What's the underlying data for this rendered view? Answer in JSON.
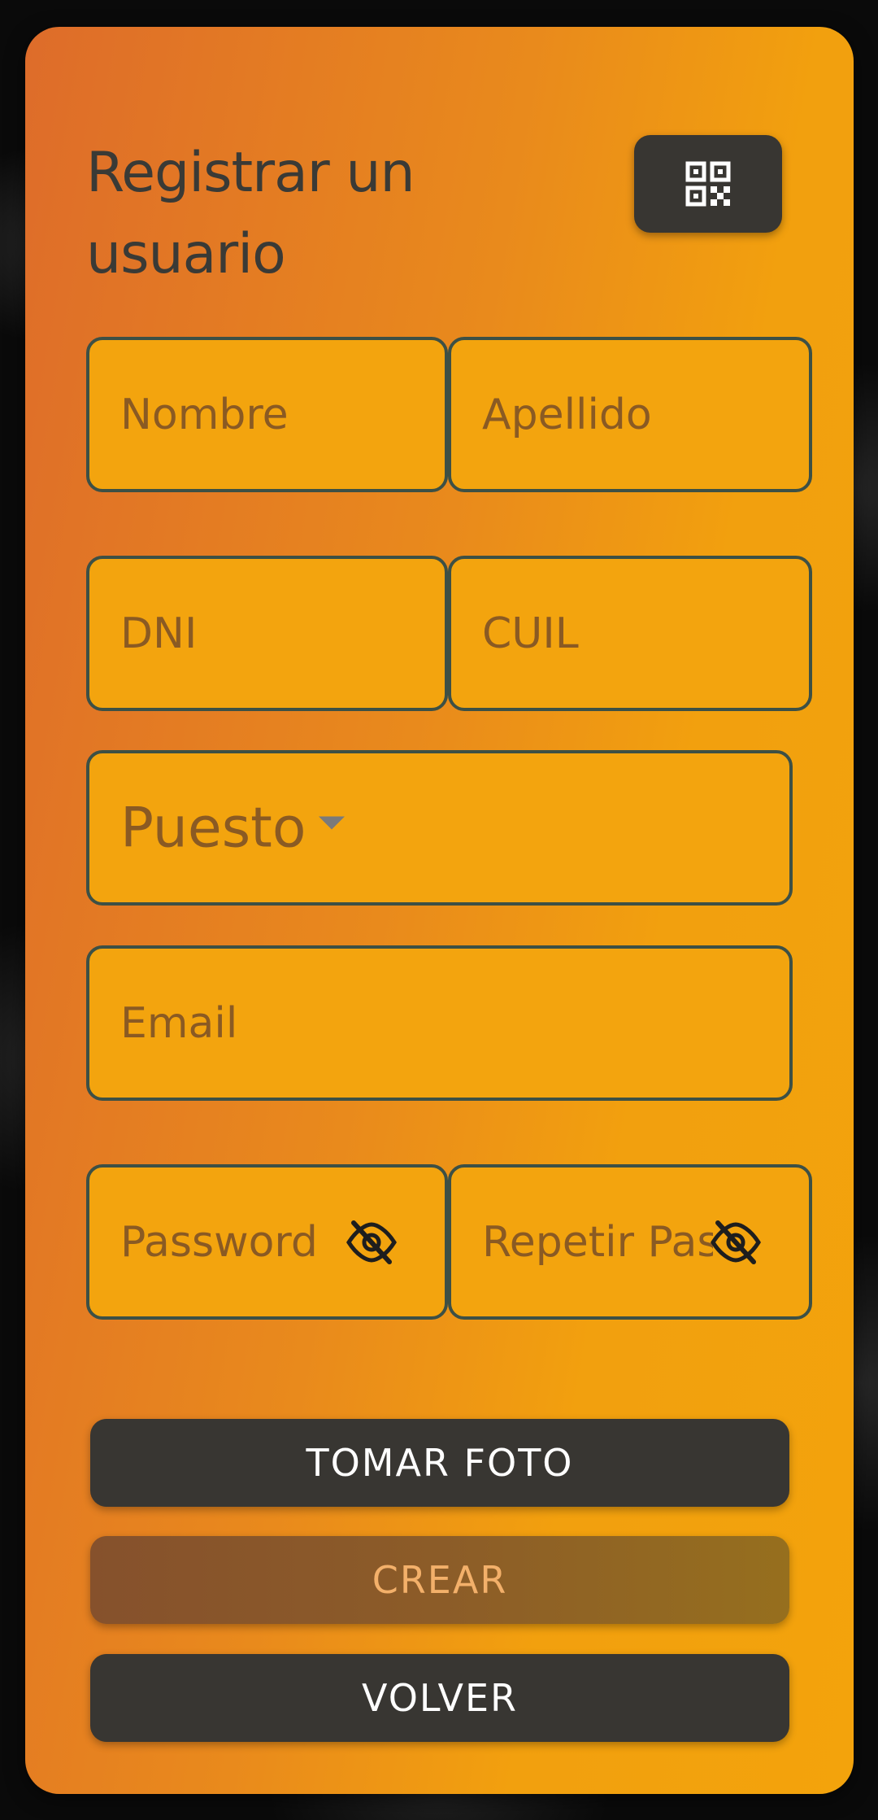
{
  "header": {
    "title": "Registrar un usuario"
  },
  "icons": {
    "qr": "qr-code-icon",
    "eye_off": "eye-off-icon",
    "dropdown": "dropdown-arrow-icon"
  },
  "form": {
    "nombre_placeholder": "Nombre",
    "apellido_placeholder": "Apellido",
    "dni_placeholder": "DNI",
    "cuil_placeholder": "CUIL",
    "puesto_label": "Puesto",
    "email_placeholder": "Email",
    "password_placeholder": "Password",
    "repeat_password_placeholder": "Repetir Password"
  },
  "buttons": {
    "take_photo": "TOMAR FOTO",
    "create": "CREAR",
    "back": "VOLVER"
  },
  "colors": {
    "accent_gradient_start": "#de6c2a",
    "accent_gradient_end": "#f3a30c",
    "dark": "#383632",
    "field_border": "#3d5045",
    "disabled_text": "#f3b06a"
  }
}
